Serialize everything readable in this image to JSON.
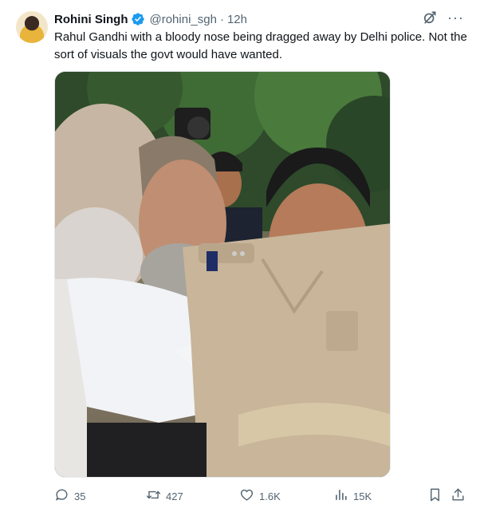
{
  "author": {
    "name": "Rohini Singh",
    "handle": "@rohini_sgh",
    "separator": "·",
    "time": "12h"
  },
  "tweet": {
    "text": "Rahul Gandhi with a bloody nose being dragged away by Delhi police. Not the sort of visuals the govt would have wanted."
  },
  "actions": {
    "replies": "35",
    "retweets": "427",
    "likes": "1.6K",
    "views": "15K"
  },
  "header_menu": "···",
  "icons": [
    "verified-badge-icon",
    "grok-icon",
    "more-icon",
    "reply-icon",
    "retweet-icon",
    "like-icon",
    "views-icon",
    "bookmark-icon",
    "share-icon"
  ],
  "colors": {
    "verified": "#1d9bf0",
    "text": "#0f1419",
    "muted": "#536471"
  }
}
